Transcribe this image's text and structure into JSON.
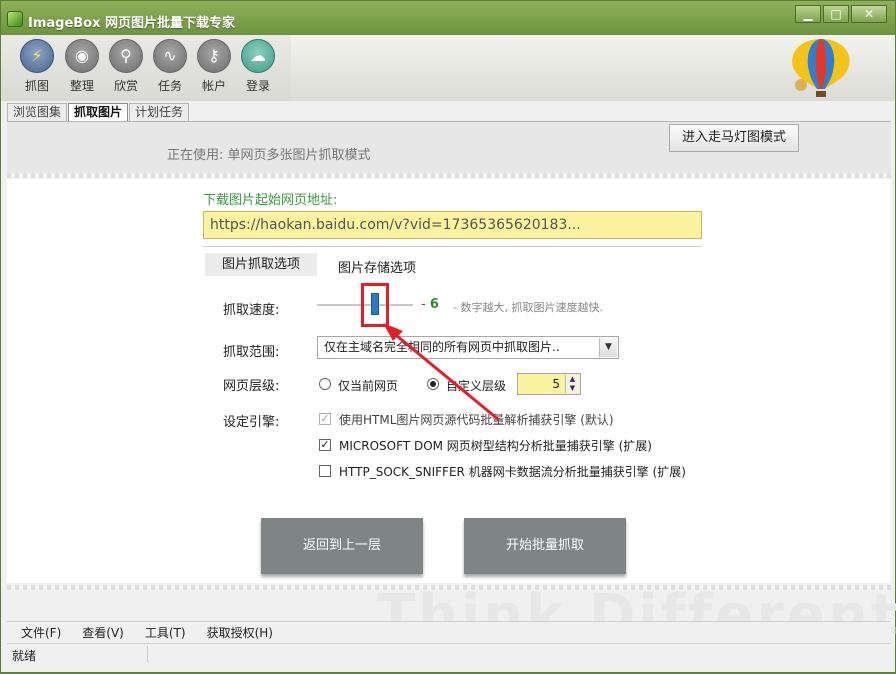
{
  "window": {
    "title": "ImageBox 网页图片批量下载专家",
    "minimize": "▁",
    "maximize": "□",
    "close": "✕"
  },
  "toolbar": {
    "items": [
      {
        "label": "抓图",
        "icon": "lightning-icon"
      },
      {
        "label": "整理",
        "icon": "disc-icon"
      },
      {
        "label": "欣赏",
        "icon": "magnifier-icon"
      },
      {
        "label": "任务",
        "icon": "wave-icon"
      },
      {
        "label": "帐户",
        "icon": "key-icon"
      },
      {
        "label": "登录",
        "icon": "cloud-upload-icon"
      }
    ]
  },
  "tabs": [
    "浏览图集",
    "抓取图片",
    "计划任务"
  ],
  "mode": {
    "current": "正在使用: 单网页多张图片抓取模式",
    "switch_button": "进入走马灯图模式"
  },
  "form": {
    "url_label": "下载图片起始网页地址:",
    "url_value": "https://haokan.baidu.com/v?vid=17365365620183...",
    "option_tabs": [
      "图片抓取选项",
      "图片存储选项"
    ],
    "speed_label": "抓取速度:",
    "speed_value": "6",
    "speed_level_fraction": 0.6,
    "speed_hint": "- 数字越大, 抓取图片速度越快.",
    "scope_label": "抓取范围:",
    "scope_value": "仅在主域名完全相同的所有网页中抓取图片..",
    "depth_label": "网页层级:",
    "depth_option_current": "仅当前网页",
    "depth_option_custom": "自定义层级",
    "depth_value": "5",
    "engine_label": "设定引擎:",
    "engines": [
      {
        "label": "使用HTML图片网页源代码批量解析捕获引擎 (默认)",
        "checked": true,
        "disabled": true
      },
      {
        "label": "MICROSOFT DOM 网页树型结构分析批量捕获引擎 (扩展)",
        "checked": true,
        "disabled": false
      },
      {
        "label": "HTTP_SOCK_SNIFFER 机器网卡数据流分析批量捕获引擎 (扩展)",
        "checked": false,
        "disabled": false
      }
    ],
    "back_button": "返回到上一层",
    "start_button": "开始批量抓取"
  },
  "watermark": "Think Different",
  "menubar": [
    "文件(F)",
    "查看(V)",
    "工具(T)",
    "获取授权(H)"
  ],
  "status": "就绪",
  "colors": {
    "accent_green": "#3a9a3a",
    "highlight_red": "#e0202a",
    "url_bg": "#fbf3a0",
    "button_gray": "#7f8585"
  }
}
